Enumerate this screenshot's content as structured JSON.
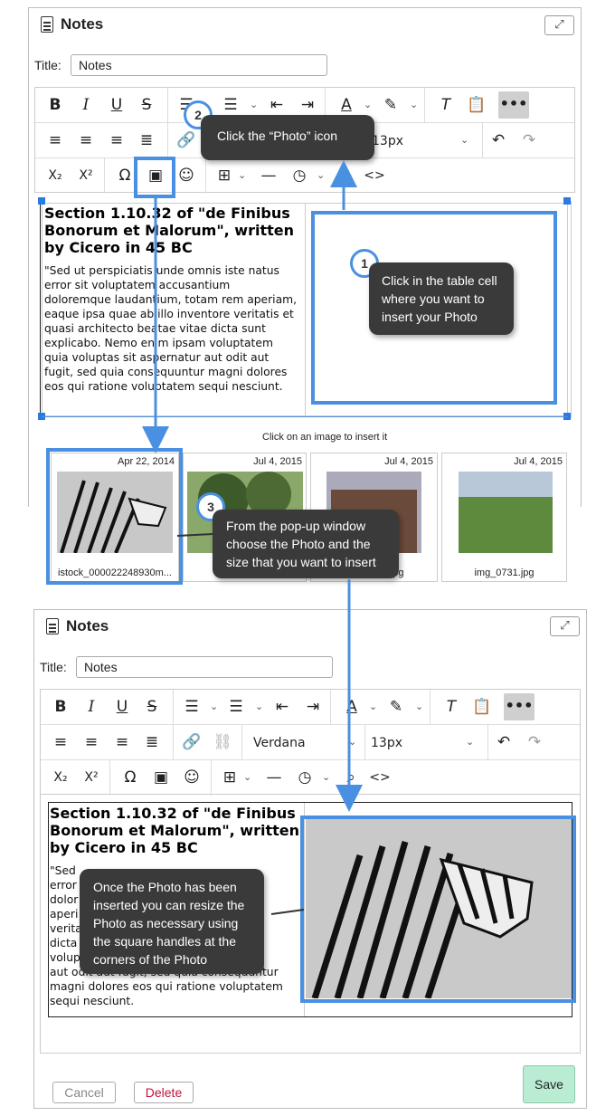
{
  "top_panel": {
    "title": "Notes",
    "title_label": "Title:",
    "title_value": "Notes",
    "heading": "Section 1.10.32 of \"de Finibus Bonorum et Malorum\", written by Cicero in 45 BC",
    "paragraph": "\"Sed ut perspiciatis unde omnis iste natus error sit voluptatem accusantium doloremque laudantium, totam rem aperiam, eaque ipsa quae ab illo inventore veritatis et quasi architecto beatae vitae dicta sunt explicabo. Nemo enim ipsam voluptatem quia voluptas sit aspernatur aut odit aut fugit, sed quia consequuntur magni dolores eos qui ratione voluptatem sequi nesciunt.",
    "font_size": "13px",
    "gallery_hint": "Click on an image to insert it"
  },
  "gallery": [
    {
      "date": "Apr 22, 2014",
      "name": "istock_000022248930m..."
    },
    {
      "date": "Jul 4, 2015",
      "name": "img_0..."
    },
    {
      "date": "Jul 4, 2015",
      "name": "img_0771.jpg"
    },
    {
      "date": "Jul 4, 2015",
      "name": "img_0731.jpg"
    }
  ],
  "callouts": {
    "step1_num": "1",
    "step1": "Click in the table cell where you want to insert your Photo",
    "step2_num": "2",
    "step2": "Click the “Photo” icon",
    "step3_num": "3",
    "step3": "From the pop-up window choose the Photo and the size that you want to insert",
    "step4": "Once the Photo has been inserted you can resize the Photo as necessary using the square handles at the corners of the Photo"
  },
  "bottom_panel": {
    "title": "Notes",
    "title_label": "Title:",
    "title_value": "Notes",
    "font_family": "Verdana",
    "font_size": "13px",
    "heading": "Section 1.10.32 of \"de Finibus Bonorum et Malorum\", written by Cicero in 45 BC",
    "para_lines": [
      "\"Sed",
      "error",
      "dolor",
      "aperi",
      "verita",
      "dicta",
      "volup"
    ],
    "para_tail": [
      "aut odit aut fugit, sed quia consequuntur",
      "magni dolores eos qui ratione voluptatem",
      "sequi nesciunt."
    ],
    "cancel": "Cancel",
    "delete": "Delete",
    "save": "Save"
  },
  "icons": {
    "bold": "B",
    "italic": "I",
    "underline": "U",
    "strike": "S",
    "subscript": "X₂",
    "superscript": "X²",
    "omega": "Ω",
    "more": "•••"
  },
  "colors": {
    "accent": "#4a90e2",
    "callout": "#3a3a3a",
    "save_bg": "#b9ecd2",
    "delete": "#c0143c"
  }
}
